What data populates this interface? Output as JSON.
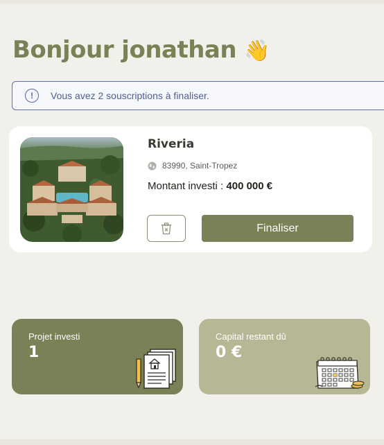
{
  "greeting": {
    "text": "Bonjour jonathan",
    "emoji": "👋"
  },
  "alert": {
    "icon": "exclamation-circle-icon",
    "text": "Vous avez 2 souscriptions à finaliser."
  },
  "subscription": {
    "name": "Riveria",
    "location_icon": "globe-icon",
    "location": "83990, Saint-Tropez",
    "amount_label": "Montant investi : ",
    "amount_value": "400 000 €",
    "delete_icon": "trash-icon",
    "finalize_label": "Finaliser"
  },
  "stats": [
    {
      "label": "Projet investi",
      "value": "1",
      "icon": "documents-icon"
    },
    {
      "label": "Capital restant dû",
      "value": "0 €",
      "icon": "calendar-icon"
    }
  ],
  "colors": {
    "accent": "#7b8157",
    "accent_light": "#b6b895",
    "background": "#f1f0ea",
    "alert_border": "#5d6fa8"
  }
}
